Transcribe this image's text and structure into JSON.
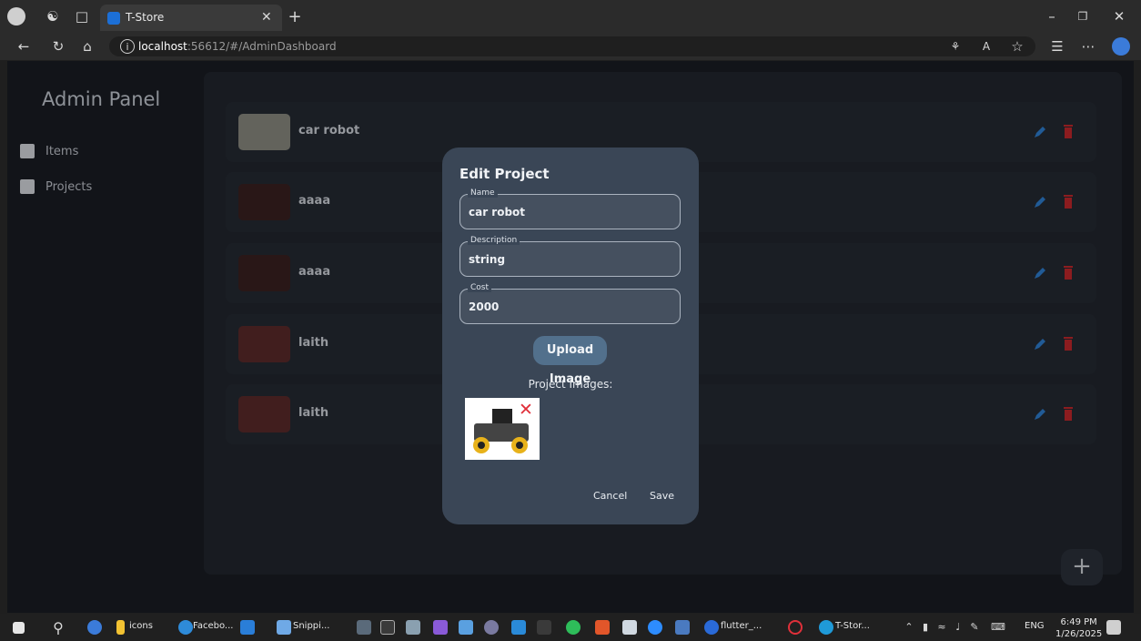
{
  "browser": {
    "tab_title": "T-Store",
    "url_host": "localhost",
    "url_rest": ":56612/#/AdminDashboard"
  },
  "sidebar": {
    "title": "Admin Panel",
    "items": [
      {
        "label": "Items",
        "icon": "archive-icon"
      },
      {
        "label": "Projects",
        "icon": "briefcase-icon"
      }
    ]
  },
  "list": {
    "rows": [
      {
        "name": "car robot",
        "thumb_color": "#8a8a80"
      },
      {
        "name": "aaaa",
        "thumb_color": "#3a2020"
      },
      {
        "name": "aaaa",
        "thumb_color": "#3a2020"
      },
      {
        "name": "laith",
        "thumb_color": "#5a2a2a"
      },
      {
        "name": "laith",
        "thumb_color": "#5a2a2a"
      }
    ],
    "edit_color": "#2f7fd0",
    "delete_color": "#c3272b"
  },
  "fab": {
    "label": "+"
  },
  "dialog": {
    "title": "Edit Project",
    "fields": [
      {
        "label": "Name",
        "value": "car robot"
      },
      {
        "label": "Description",
        "value": "string"
      },
      {
        "label": "Cost",
        "value": "2000"
      }
    ],
    "upload_label": "Upload Image",
    "images_label": "Project Images:",
    "cancel_label": "Cancel",
    "save_label": "Save"
  },
  "taskbar": {
    "labels": [
      "icons",
      "Facebo...",
      "Snippi...",
      "flutter_...",
      "T-Stor..."
    ],
    "lang": "ENG",
    "time": "6:49 PM",
    "date": "1/26/2025"
  }
}
